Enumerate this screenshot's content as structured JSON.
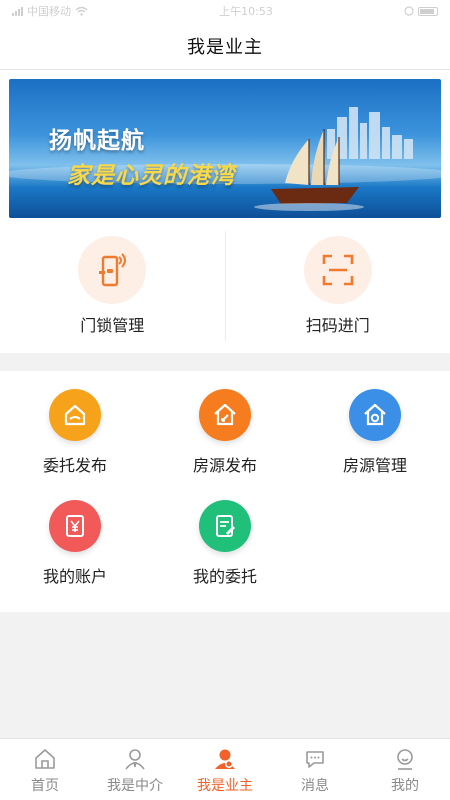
{
  "status_bar": {
    "carrier": "中国移动",
    "time": "上午10:53"
  },
  "nav": {
    "title": "我是业主"
  },
  "banner": {
    "line1": "扬帆起航",
    "line2": "家是心灵的港湾"
  },
  "top_actions": [
    {
      "label": "门锁管理",
      "icon": "smart-lock-icon"
    },
    {
      "label": "扫码进门",
      "icon": "scan-icon"
    }
  ],
  "grid": [
    {
      "label": "委托发布",
      "icon": "delegate-publish-icon",
      "color": "#f7a21b"
    },
    {
      "label": "房源发布",
      "icon": "house-publish-icon",
      "color": "#f57c1f"
    },
    {
      "label": "房源管理",
      "icon": "house-manage-icon",
      "color": "#3b8fe6"
    },
    {
      "label": "我的账户",
      "icon": "wallet-icon",
      "color": "#f25a5a"
    },
    {
      "label": "我的委托",
      "icon": "my-delegate-icon",
      "color": "#21c07a"
    }
  ],
  "tabs": [
    {
      "label": "首页",
      "icon": "home-icon",
      "active": false
    },
    {
      "label": "我是中介",
      "icon": "agent-icon",
      "active": false
    },
    {
      "label": "我是业主",
      "icon": "owner-icon",
      "active": true
    },
    {
      "label": "消息",
      "icon": "message-icon",
      "active": false
    },
    {
      "label": "我的",
      "icon": "profile-icon",
      "active": false
    }
  ],
  "colors": {
    "accent": "#f0622a",
    "icon_bg": "#fdeee6",
    "icon_stroke": "#f07a2e"
  }
}
